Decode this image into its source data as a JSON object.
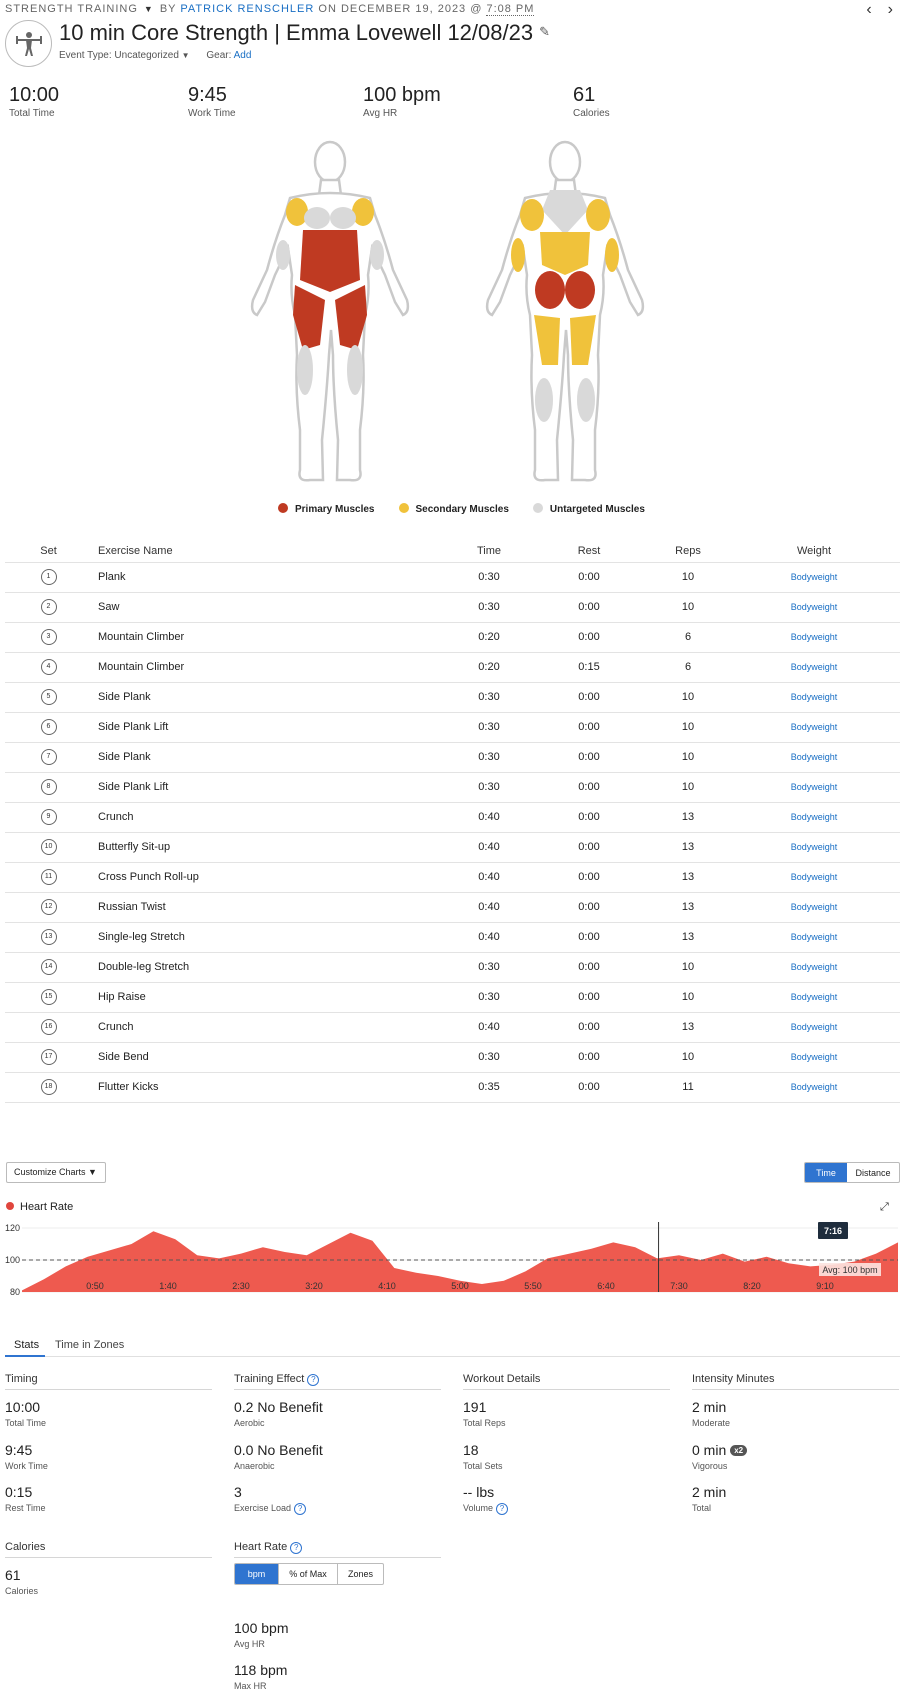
{
  "header": {
    "activity_type": "STRENGTH TRAINING",
    "by_label": "BY",
    "author": "PATRICK RENSCHLER",
    "on_label": "ON DECEMBER 19, 2023 @",
    "time": "7:08 PM",
    "title": "10 min Core Strength | Emma Lovewell 12/08/23",
    "event_type_label": "Event Type: Uncategorized",
    "gear_label": "Gear:",
    "gear_add": "Add"
  },
  "summary": [
    {
      "value": "10:00",
      "label": "Total Time"
    },
    {
      "value": "9:45",
      "label": "Work Time"
    },
    {
      "value": "100 bpm",
      "label": "Avg HR"
    },
    {
      "value": "61",
      "label": "Calories"
    }
  ],
  "muscle_legend": [
    {
      "label": "Primary Muscles",
      "color": "#bf3a22"
    },
    {
      "label": "Secondary Muscles",
      "color": "#f0c23b"
    },
    {
      "label": "Untargeted Muscles",
      "color": "#d9d9d9"
    }
  ],
  "table": {
    "headers": {
      "set": "Set",
      "name": "Exercise Name",
      "time": "Time",
      "rest": "Rest",
      "reps": "Reps",
      "weight": "Weight"
    },
    "rows": [
      {
        "set": "1",
        "name": "Plank",
        "time": "0:30",
        "rest": "0:00",
        "reps": "10",
        "weight": "Bodyweight"
      },
      {
        "set": "2",
        "name": "Saw",
        "time": "0:30",
        "rest": "0:00",
        "reps": "10",
        "weight": "Bodyweight"
      },
      {
        "set": "3",
        "name": "Mountain Climber",
        "time": "0:20",
        "rest": "0:00",
        "reps": "6",
        "weight": "Bodyweight"
      },
      {
        "set": "4",
        "name": "Mountain Climber",
        "time": "0:20",
        "rest": "0:15",
        "reps": "6",
        "weight": "Bodyweight"
      },
      {
        "set": "5",
        "name": "Side Plank",
        "time": "0:30",
        "rest": "0:00",
        "reps": "10",
        "weight": "Bodyweight"
      },
      {
        "set": "6",
        "name": "Side Plank Lift",
        "time": "0:30",
        "rest": "0:00",
        "reps": "10",
        "weight": "Bodyweight"
      },
      {
        "set": "7",
        "name": "Side Plank",
        "time": "0:30",
        "rest": "0:00",
        "reps": "10",
        "weight": "Bodyweight"
      },
      {
        "set": "8",
        "name": "Side Plank Lift",
        "time": "0:30",
        "rest": "0:00",
        "reps": "10",
        "weight": "Bodyweight"
      },
      {
        "set": "9",
        "name": "Crunch",
        "time": "0:40",
        "rest": "0:00",
        "reps": "13",
        "weight": "Bodyweight"
      },
      {
        "set": "10",
        "name": "Butterfly Sit-up",
        "time": "0:40",
        "rest": "0:00",
        "reps": "13",
        "weight": "Bodyweight"
      },
      {
        "set": "11",
        "name": "Cross Punch Roll-up",
        "time": "0:40",
        "rest": "0:00",
        "reps": "13",
        "weight": "Bodyweight"
      },
      {
        "set": "12",
        "name": "Russian Twist",
        "time": "0:40",
        "rest": "0:00",
        "reps": "13",
        "weight": "Bodyweight"
      },
      {
        "set": "13",
        "name": "Single-leg Stretch",
        "time": "0:40",
        "rest": "0:00",
        "reps": "13",
        "weight": "Bodyweight"
      },
      {
        "set": "14",
        "name": "Double-leg Stretch",
        "time": "0:30",
        "rest": "0:00",
        "reps": "10",
        "weight": "Bodyweight"
      },
      {
        "set": "15",
        "name": "Hip Raise",
        "time": "0:30",
        "rest": "0:00",
        "reps": "10",
        "weight": "Bodyweight"
      },
      {
        "set": "16",
        "name": "Crunch",
        "time": "0:40",
        "rest": "0:00",
        "reps": "13",
        "weight": "Bodyweight"
      },
      {
        "set": "17",
        "name": "Side Bend",
        "time": "0:30",
        "rest": "0:00",
        "reps": "10",
        "weight": "Bodyweight"
      },
      {
        "set": "18",
        "name": "Flutter Kicks",
        "time": "0:35",
        "rest": "0:00",
        "reps": "11",
        "weight": "Bodyweight"
      }
    ]
  },
  "charts_controls": {
    "customize_label": "Customize Charts",
    "time_label": "Time",
    "distance_label": "Distance"
  },
  "chart_data": {
    "type": "area",
    "title": "Heart Rate",
    "color": "#ee5a4f",
    "y_ticks": [
      "120",
      "100",
      "80"
    ],
    "ylim": [
      80,
      120
    ],
    "x_ticks": [
      "0:50",
      "1:40",
      "2:30",
      "3:20",
      "4:10",
      "5:00",
      "5:50",
      "6:40",
      "7:30",
      "8:20",
      "9:10"
    ],
    "x": [
      "0:00",
      "0:15",
      "0:30",
      "0:45",
      "1:00",
      "1:15",
      "1:30",
      "1:45",
      "2:00",
      "2:15",
      "2:30",
      "2:45",
      "3:00",
      "3:15",
      "3:30",
      "3:45",
      "4:00",
      "4:15",
      "4:30",
      "4:45",
      "5:00",
      "5:15",
      "5:30",
      "5:45",
      "6:00",
      "6:15",
      "6:30",
      "6:45",
      "7:00",
      "7:15",
      "7:30",
      "7:45",
      "8:00",
      "8:15",
      "8:30",
      "8:45",
      "9:00",
      "9:15",
      "9:30",
      "9:45",
      "10:00"
    ],
    "values": [
      81,
      88,
      96,
      102,
      106,
      110,
      118,
      113,
      103,
      101,
      104,
      108,
      105,
      103,
      110,
      117,
      112,
      95,
      92,
      90,
      87,
      85,
      87,
      93,
      101,
      104,
      107,
      111,
      108,
      101,
      103,
      100,
      104,
      99,
      102,
      98,
      96,
      97,
      99,
      104,
      111
    ],
    "avg_label": "Avg: 100 bpm",
    "avg_value": 100,
    "cursor_label": "7:16",
    "cursor_x": "7:16"
  },
  "tabs": [
    "Stats",
    "Time in Zones"
  ],
  "stats": {
    "timing": {
      "title": "Timing",
      "items": [
        {
          "value": "10:00",
          "label": "Total Time"
        },
        {
          "value": "9:45",
          "label": "Work Time"
        },
        {
          "value": "0:15",
          "label": "Rest Time"
        }
      ]
    },
    "training_effect": {
      "title": "Training Effect",
      "items": [
        {
          "value": "0.2 No Benefit",
          "label": "Aerobic"
        },
        {
          "value": "0.0 No Benefit",
          "label": "Anaerobic"
        },
        {
          "value": "3",
          "label": "Exercise Load"
        }
      ]
    },
    "workout_details": {
      "title": "Workout Details",
      "items": [
        {
          "value": "191",
          "label": "Total Reps"
        },
        {
          "value": "18",
          "label": "Total Sets"
        },
        {
          "value": "-- lbs",
          "label": "Volume"
        }
      ]
    },
    "intensity": {
      "title": "Intensity Minutes",
      "items": [
        {
          "value": "2 min",
          "label": "Moderate"
        },
        {
          "value": "0 min",
          "label": "Vigorous",
          "badge": "x2"
        },
        {
          "value": "2 min",
          "label": "Total"
        }
      ]
    },
    "calories": {
      "title": "Calories",
      "items": [
        {
          "value": "61",
          "label": "Calories"
        }
      ]
    },
    "heart_rate": {
      "title": "Heart Rate",
      "toggle": [
        "bpm",
        "% of Max",
        "Zones"
      ],
      "items": [
        {
          "value": "100 bpm",
          "label": "Avg HR"
        },
        {
          "value": "118 bpm",
          "label": "Max HR"
        }
      ]
    }
  }
}
